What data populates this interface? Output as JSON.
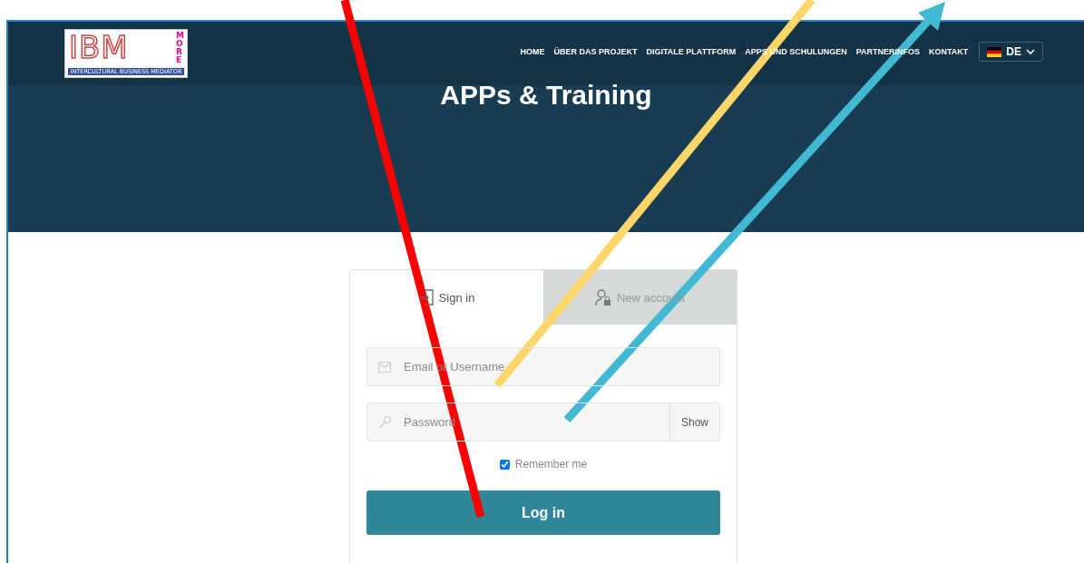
{
  "logo": {
    "letters": "IBM",
    "side": "MORE",
    "tagline": "INTERCULTURAL BUSINESS MEDIATOR"
  },
  "nav": {
    "items": [
      {
        "label": "HOME"
      },
      {
        "label": "ÜBER DAS PROJEKT"
      },
      {
        "label": "DIGITALE PLATTFORM"
      },
      {
        "label": "APPS UND SCHULUNGEN"
      },
      {
        "label": "PARTNERINFOS"
      },
      {
        "label": "KONTAKT"
      }
    ],
    "language": "DE"
  },
  "hero": {
    "title": "APPs & Training"
  },
  "tabs": [
    {
      "label": "Sign in",
      "kind": "signin",
      "selected": true
    },
    {
      "label": "New account",
      "kind": "account",
      "selected": false
    }
  ],
  "fields": [
    {
      "kind": "email",
      "placeholder": "Email or Username"
    },
    {
      "kind": "password",
      "placeholder": "Password",
      "toggle": "Show"
    }
  ],
  "remember": {
    "label": "Remember me",
    "checked": true
  },
  "submit": "Log in"
}
